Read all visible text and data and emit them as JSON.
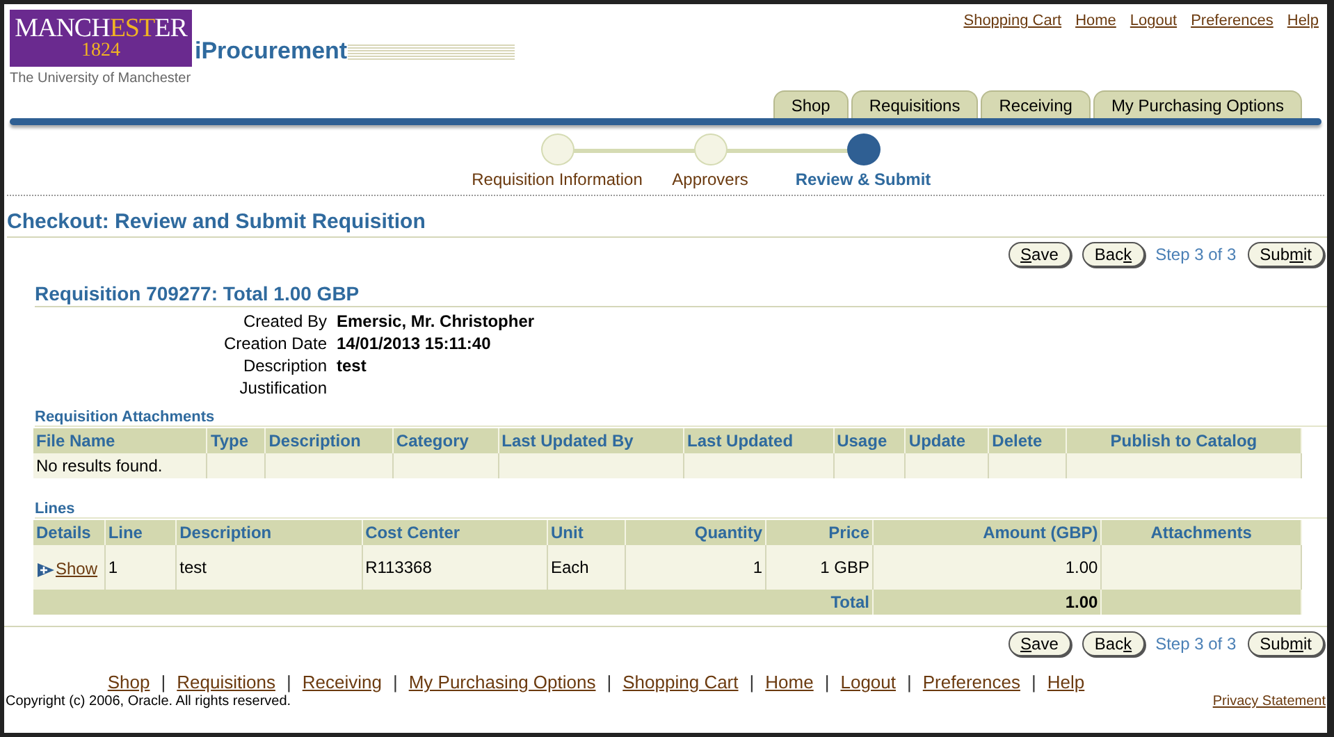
{
  "logo": {
    "word": [
      {
        "text": "MANCH",
        "accent": false
      },
      {
        "text": "EST",
        "accent": true
      },
      {
        "text": "ER",
        "accent": false
      }
    ],
    "year": "1824",
    "subtitle": "The University of Manchester"
  },
  "app_name": "iProcurement",
  "global_links": [
    "Shopping Cart",
    "Home",
    "Logout",
    "Preferences",
    "Help"
  ],
  "tabs": [
    {
      "label": "Shop",
      "selected": false
    },
    {
      "label": "Requisitions",
      "selected": false
    },
    {
      "label": "Receiving",
      "selected": false
    },
    {
      "label": "My Purchasing Options",
      "selected": false
    }
  ],
  "train": [
    {
      "label": "Requisition Information",
      "selected": false
    },
    {
      "label": "Approvers",
      "selected": false
    },
    {
      "label": "Review & Submit",
      "selected": true
    }
  ],
  "page_title": "Checkout: Review and Submit Requisition",
  "action_bar": {
    "buttons": [
      {
        "key": "S",
        "after": "ave"
      },
      {
        "before": "Bac",
        "key": "k"
      },
      {
        "before": "Sub",
        "key": "m",
        "after": "it"
      }
    ],
    "step": "Step 3 of 3"
  },
  "requisition": {
    "title": "Requisition 709277: Total 1.00 GBP",
    "fields": [
      {
        "label": "Created By",
        "value": "Emersic, Mr. Christopher"
      },
      {
        "label": "Creation Date",
        "value": "14/01/2013 15:11:40"
      },
      {
        "label": "Description",
        "value": "test"
      },
      {
        "label": "Justification"
      }
    ]
  },
  "attachments": {
    "title": "Requisition Attachments",
    "columns": [
      "File Name",
      "Type",
      "Description",
      "Category",
      "Last Updated By",
      "Last Updated",
      "Usage",
      "Update",
      "Delete",
      "Publish to Catalog"
    ],
    "empty": "No results found."
  },
  "lines": {
    "title": "Lines",
    "columns": [
      "Details",
      "Line",
      "Description",
      "Cost Center",
      "Unit",
      "Quantity",
      "Price",
      "Amount (GBP)",
      "Attachments"
    ],
    "rows": [
      {
        "details": "Show",
        "line": "1",
        "description": "test",
        "cost_center": "R113368",
        "unit": "Each",
        "quantity": "1",
        "price": "1 GBP",
        "amount": "1.00"
      }
    ],
    "total_label": "Total",
    "total": "1.00"
  },
  "bottom_action_bar": {
    "buttons": [
      {
        "key": "S",
        "after": "ave"
      },
      {
        "before": "Bac",
        "key": "k"
      },
      {
        "before": "Sub",
        "key": "m",
        "after": "it"
      }
    ],
    "step": "Step 3 of 3"
  },
  "footer_separator": "|",
  "footer_links": [
    "Shop",
    "Requisitions",
    "Receiving",
    "My Purchasing Options",
    "Shopping Cart",
    "Home",
    "Logout",
    "Preferences",
    "Help"
  ],
  "copyright": "Copyright (c) 2006, Oracle. All rights reserved.",
  "privacy": "Privacy Statement"
}
